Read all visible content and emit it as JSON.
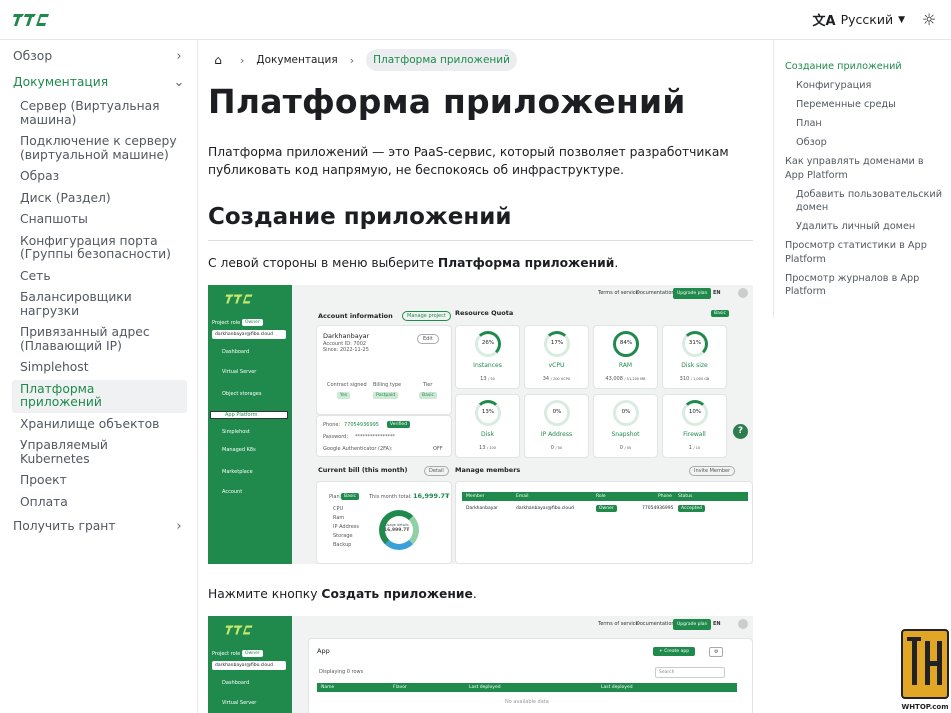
{
  "brand": {
    "logo_text": "ITC",
    "accent": "#1f8a4c"
  },
  "navbar": {
    "language": "Русский",
    "language_icon": "translate-icon",
    "theme_icon": "sun-icon"
  },
  "sidebar": {
    "items": [
      {
        "label": "Обзор",
        "state": "collapsed"
      },
      {
        "label": "Документация",
        "state": "expanded"
      }
    ],
    "docs_children": [
      "Сервер (Виртуальная машина)",
      "Подключение к серверу (виртуальной машине)",
      "Образ",
      "Диск (Раздел)",
      "Снапшоты",
      "Конфигурация порта (Группы безопасности)",
      "Сеть",
      "Балансировщики нагрузки",
      "Привязанный адрес (Плавающий IP)",
      "Simplehost",
      "Платформа приложений",
      "Хранилище объектов",
      "Управляемый Kubernetes",
      "Проект",
      "Оплата"
    ],
    "bottom_item": "Получить грант"
  },
  "breadcrumb": {
    "home_icon": "home-icon",
    "section": "Документация",
    "current": "Платформа приложений"
  },
  "main": {
    "title": "Платформа приложений",
    "intro": "Платформа приложений — это PaaS-сервис, который позволяет разработчикам публиковать код напрямую, не беспокоясь об инфраструктуре.",
    "h2": "Создание приложений",
    "step1_prefix": "С левой стороны в меню выберите ",
    "step1_bold": "Платформа приложений",
    "step1_suffix": ".",
    "step2_prefix": "Нажмите кнопку ",
    "step2_bold": "Создать приложение",
    "step2_suffix": "."
  },
  "screenshot1": {
    "top_links": [
      "Terms of service",
      "Documentation"
    ],
    "upgrade": "Upgrade plan",
    "lang": "EN",
    "project_role": "Project role",
    "role": "Owner",
    "email": "darkhanbayar@fibo.cloud",
    "menu": [
      "Dashboard",
      "Virtual Server",
      "Object storages",
      "App Platform",
      "Simplehost",
      "Managed K8s",
      "Marketplace",
      "Account"
    ],
    "account_title": "Account information",
    "manage_project": "Manage project",
    "account_name": "Darkhanbayar",
    "account_id": "Account ID: 7002",
    "since": "Since: 2022-11-25",
    "edit": "Edit",
    "contract_signed": "Contract signed",
    "billing_type": "Billing type",
    "tier": "Tier",
    "contract_val": "Yes",
    "billing_val": "Postpaid",
    "tier_val": "Basic",
    "phone_label": "Phone:",
    "phone": "77054936995",
    "verified": "Verified",
    "password_label": "Password:",
    "password": "****************",
    "ga_label": "Google Authenticator (2FA):",
    "off": "OFF",
    "quota_title": "Resource Quota",
    "basic": "Basic",
    "quotas": [
      {
        "pct": "26%",
        "name": "Instances",
        "used": "13",
        "max": "/ 50"
      },
      {
        "pct": "17%",
        "name": "vCPU",
        "used": "34",
        "max": "/ 200 VCPU"
      },
      {
        "pct": "84%",
        "name": "RAM",
        "used": "43,008",
        "max": "/ 51,200 MB"
      },
      {
        "pct": "31%",
        "name": "Disk size",
        "used": "310",
        "max": "/ 1,000 GB"
      },
      {
        "pct": "13%",
        "name": "Disk",
        "used": "13",
        "max": "/ 100"
      },
      {
        "pct": "0%",
        "name": "IP Address",
        "used": "0",
        "max": "/ 50"
      },
      {
        "pct": "0%",
        "name": "Snapshot",
        "used": "0",
        "max": "/ 50"
      },
      {
        "pct": "10%",
        "name": "Firewall",
        "used": "1",
        "max": "/ 10"
      }
    ],
    "bill_title": "Current bill (this month)",
    "detail": "Detail",
    "plan": "Plan:",
    "plan_val": "Basic",
    "month_total_label": "This month total:",
    "month_total": "16,999.7₮",
    "bill_legend": [
      "CPU",
      "Ram",
      "IP Address",
      "Storage",
      "Backup"
    ],
    "donut_label": "Usage details",
    "donut_value": "16,999.7₮",
    "members_title": "Manage members",
    "invite": "Invite Member",
    "member_cols": [
      "Member",
      "Email",
      "Role",
      "Phone",
      "Status"
    ],
    "member_row": [
      "Darkhanbayar",
      "darkhanbayar@fibo.cloud",
      "Owner",
      "77054936995",
      "Accepted"
    ]
  },
  "screenshot2": {
    "app_title": "App",
    "create_app": "+ Create app",
    "displaying": "Displaying 0 rows",
    "search": "Search",
    "cols": [
      "Name",
      "Flavor",
      "Last deployed",
      "Last deployed"
    ],
    "empty": "No available data",
    "menu": [
      "Dashboard",
      "Virtual Server"
    ]
  },
  "toc": [
    {
      "label": "Создание приложений",
      "level": 1,
      "active": true
    },
    {
      "label": "Конфигурация",
      "level": 2
    },
    {
      "label": "Переменные среды",
      "level": 2
    },
    {
      "label": "План",
      "level": 2
    },
    {
      "label": "Обзор",
      "level": 2
    },
    {
      "label": "Как управлять доменами в App Platform",
      "level": 1
    },
    {
      "label": "Добавить пользовательский домен",
      "level": 2
    },
    {
      "label": "Удалить личный домен",
      "level": 2
    },
    {
      "label": "Просмотр статистики в App Platform",
      "level": 1
    },
    {
      "label": "Просмотр журналов в App Platform",
      "level": 1
    }
  ],
  "watermark": "WHTOP.com"
}
